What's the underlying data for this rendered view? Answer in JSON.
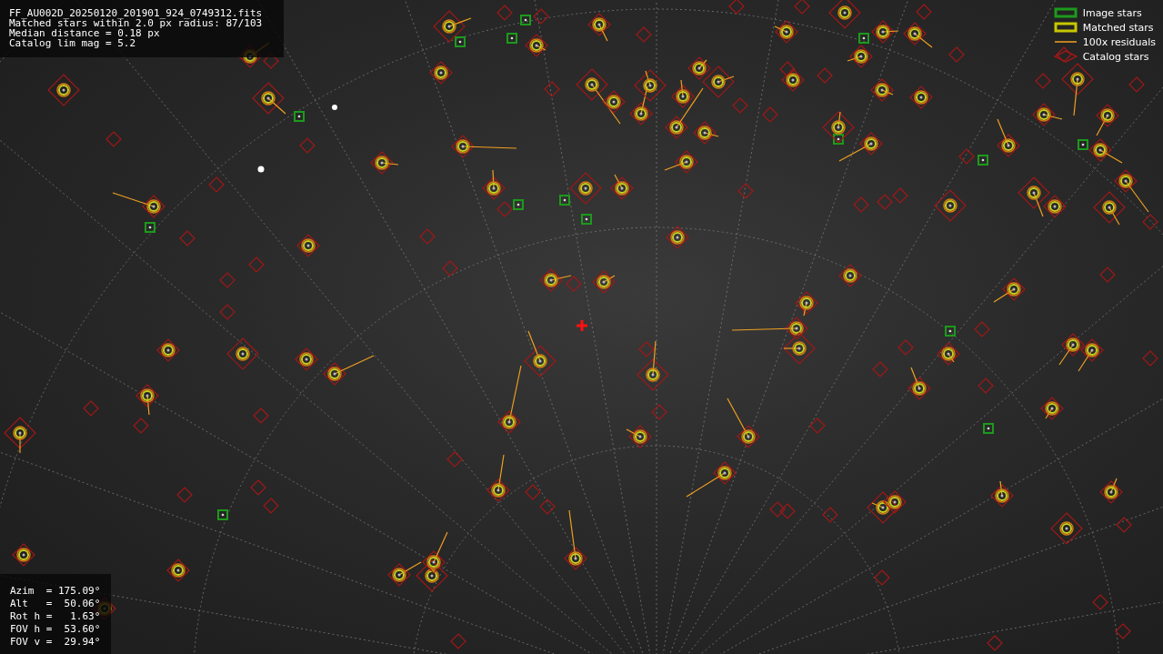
{
  "info_panel": {
    "lines": [
      "FF_AU002D_20250120_201901_924_0749312.fits",
      "Matched stars within 2.0 px radius: 87/103",
      "Median distance = 0.18 px",
      "Catalog lim mag = 5.2"
    ]
  },
  "legend": [
    {
      "kind": "image",
      "label": "Image stars"
    },
    {
      "kind": "matched",
      "label": "Matched stars"
    },
    {
      "kind": "residual",
      "label": "100x residuals"
    },
    {
      "kind": "catalog",
      "label": "Catalog stars"
    }
  ],
  "pointing_panel": {
    "lines": [
      "Azim  = 175.09°",
      "Alt   =  50.06°",
      "Rot h =   1.63°",
      "FOV h =  53.60°",
      "FOV v =  29.94°"
    ]
  }
}
